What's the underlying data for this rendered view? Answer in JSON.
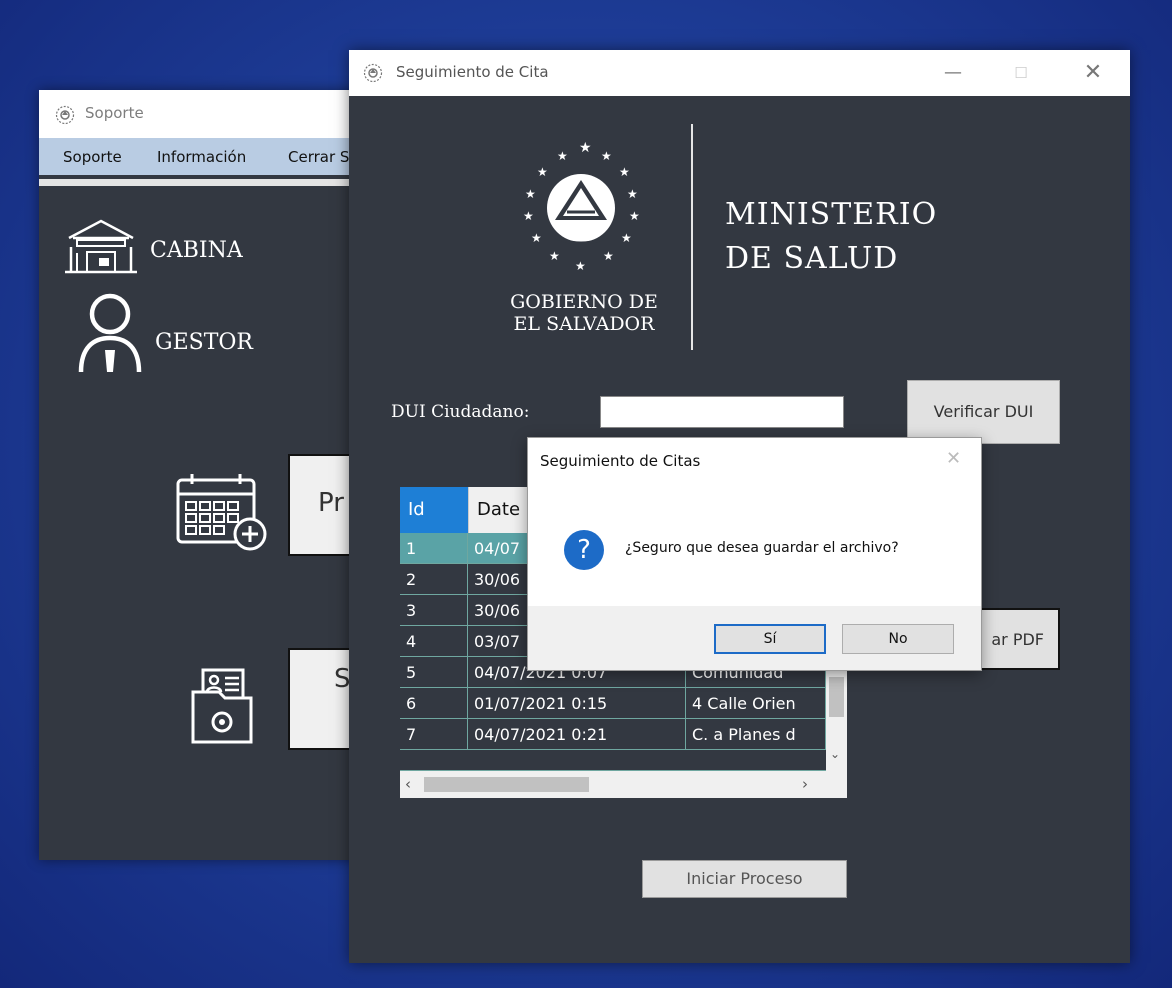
{
  "soporte_window": {
    "title": "Soporte",
    "menu": [
      "Soporte",
      "Información",
      "Cerrar S"
    ],
    "nav": {
      "cabina": "CABINA",
      "gestor": "GESTOR"
    },
    "btn_top": "Pr",
    "btn_bottom": "S"
  },
  "cita_window": {
    "title": "Seguimiento de Cita",
    "logo": {
      "gobierno_line1": "GOBIERNO DE",
      "gobierno_line2": "EL SALVADOR",
      "ministerio_line1": "MINISTERIO",
      "ministerio_line2": "DE SALUD"
    },
    "dui_label": "DUI Ciudadano:",
    "dui_value": "",
    "verify_button": "Verificar DUI",
    "pdf_button": "ar PDF",
    "start_button": "Iniciar Proceso",
    "table": {
      "headers": [
        "Id",
        "Date"
      ],
      "rows": [
        {
          "id": "1",
          "date": "04/07",
          "place": ""
        },
        {
          "id": "2",
          "date": "30/06",
          "place": ""
        },
        {
          "id": "3",
          "date": "30/06",
          "place": ""
        },
        {
          "id": "4",
          "date": "03/07",
          "place": ""
        },
        {
          "id": "5",
          "date": "04/07/2021 0:07",
          "place": "Comunidad"
        },
        {
          "id": "6",
          "date": "01/07/2021 0:15",
          "place": "4 Calle Orien"
        },
        {
          "id": "7",
          "date": "04/07/2021 0:21",
          "place": "C. a Planes d"
        }
      ],
      "selected_row": 0
    }
  },
  "dialog": {
    "title": "Seguimiento de Citas",
    "message": "¿Seguro que desea guardar el archivo?",
    "yes": "Sí",
    "no": "No",
    "icon": "question-icon"
  },
  "colors": {
    "window_bg": "#333841",
    "header_blue": "#1e7fd6",
    "selected_row": "#5aa3a6",
    "menubar": "#b9cce3"
  }
}
